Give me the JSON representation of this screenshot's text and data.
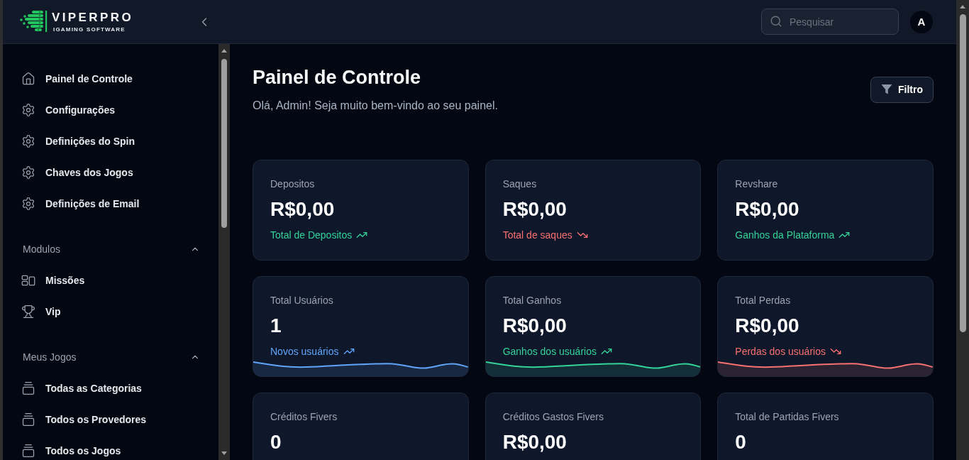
{
  "header": {
    "logo": {
      "name": "VIPERPRO",
      "tagline": "IGAMING SOFTWARE"
    },
    "search": {
      "placeholder": "Pesquisar"
    },
    "avatar": {
      "initial": "A"
    }
  },
  "sidebar": {
    "items": [
      {
        "kind": "dashboard",
        "label": "Painel de Controle"
      },
      {
        "kind": "settings",
        "label": "Configurações"
      },
      {
        "kind": "settings",
        "label": "Definições do Spin"
      },
      {
        "kind": "settings",
        "label": "Chaves dos Jogos"
      },
      {
        "kind": "settings",
        "label": "Definições de Email"
      }
    ],
    "sections": [
      {
        "title": "Modulos",
        "expanded": true,
        "items": [
          {
            "kind": "missions",
            "label": "Missões"
          },
          {
            "kind": "vip",
            "label": "Vip"
          }
        ]
      },
      {
        "title": "Meus Jogos",
        "expanded": true,
        "items": [
          {
            "kind": "games",
            "label": "Todas as Categorias"
          },
          {
            "kind": "games",
            "label": "Todos os Provedores"
          },
          {
            "kind": "games",
            "label": "Todos os Jogos"
          }
        ]
      }
    ]
  },
  "page": {
    "title": "Painel de Controle",
    "subtitle": "Olá, Admin! Seja muito bem-vindo ao seu painel.",
    "filter_button": "Filtro"
  },
  "cards": [
    {
      "kind": "up",
      "label": "Depositos",
      "value": "R$0,00",
      "note": "Total de Depositos",
      "color": "#34d399",
      "sparkline": false
    },
    {
      "kind": "down",
      "label": "Saques",
      "value": "R$0,00",
      "note": "Total de saques",
      "color": "#f87171",
      "sparkline": false
    },
    {
      "kind": "up",
      "label": "Revshare",
      "value": "R$0,00",
      "note": "Ganhos da Plataforma",
      "color": "#34d399",
      "sparkline": false
    },
    {
      "kind": "up",
      "label": "Total Usuários",
      "value": "1",
      "note": "Novos usuários",
      "color": "#60a5fa",
      "sparkline": true
    },
    {
      "kind": "up",
      "label": "Total Ganhos",
      "value": "R$0,00",
      "note": "Ganhos dos usuários",
      "color": "#34d399",
      "sparkline": true
    },
    {
      "kind": "down",
      "label": "Total Perdas",
      "value": "R$0,00",
      "note": "Perdas dos usuários",
      "color": "#f87171",
      "sparkline": true
    },
    {
      "label": "Créditos Fivers",
      "value": "0",
      "sparkline": false
    },
    {
      "label": "Créditos Gastos Fivers",
      "value": "R$0,00",
      "sparkline": false
    },
    {
      "label": "Total de Partidas Fivers",
      "value": "0",
      "sparkline": false
    }
  ]
}
